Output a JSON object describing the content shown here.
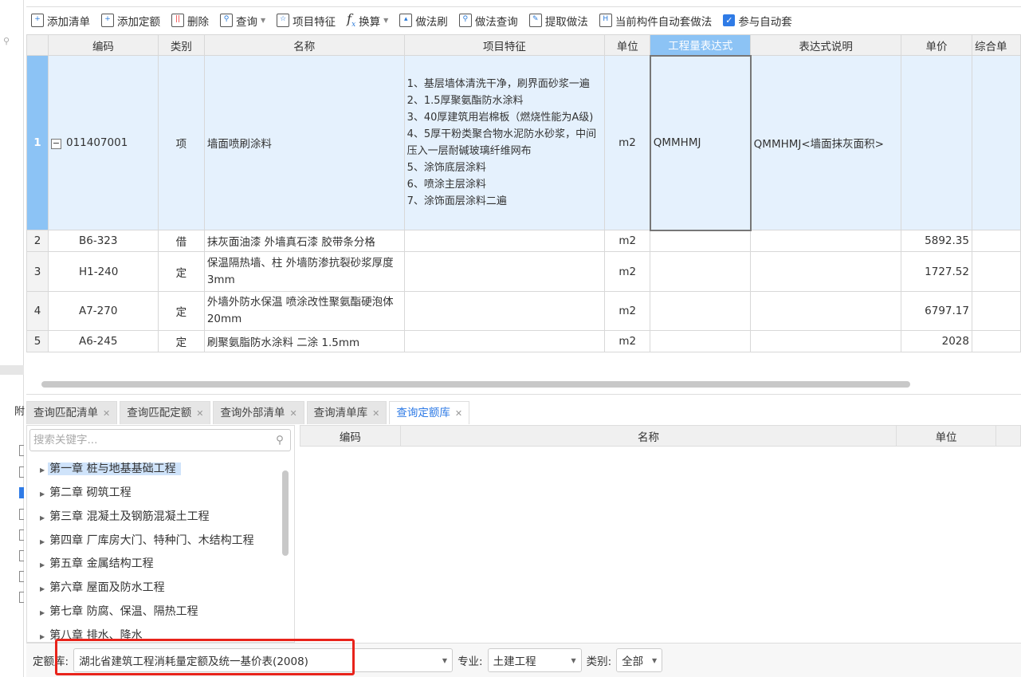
{
  "toolbar": {
    "items": [
      "添加清单",
      "添加定额",
      "删除",
      "查询",
      "项目特征",
      "换算",
      "做法刷",
      "做法查询",
      "提取做法",
      "当前构件自动套做法"
    ],
    "auto_checkbox": "参与自动套"
  },
  "grid": {
    "headers": [
      "",
      "编码",
      "类别",
      "名称",
      "项目特征",
      "单位",
      "工程量表达式",
      "表达式说明",
      "单价",
      "综合单"
    ],
    "rows": [
      {
        "no": "1",
        "code": "011407001",
        "type": "项",
        "name": "墙面喷刷涂料",
        "feature": [
          "1、基层墙体清洗干净，刷界面砂浆一遍",
          "2、1.5厚聚氨酯防水涂料",
          "3、40厚建筑用岩棉板（燃烧性能为A级)",
          "4、5厚干粉类聚合物水泥防水砂浆，中间压入一层耐碱玻璃纤维网布",
          "5、涂饰底层涂料",
          "6、喷涂主层涂料",
          "7、涂饰面层涂料二遍"
        ],
        "unit": "m2",
        "expr": "QMMHMJ",
        "expr_desc": "QMMHMJ<墙面抹灰面积>",
        "price": ""
      },
      {
        "no": "2",
        "code": "B6-323",
        "type": "借",
        "name": "抹灰面油漆 外墙真石漆 胶带条分格",
        "unit": "m2",
        "price": "5892.35"
      },
      {
        "no": "3",
        "code": "H1-240",
        "type": "定",
        "name": "保温隔热墙、柱 外墙防渗抗裂砂浆厚度3mm",
        "unit": "m2",
        "price": "1727.52"
      },
      {
        "no": "4",
        "code": "A7-270",
        "type": "定",
        "name": "外墙外防水保温 喷涂改性聚氨酯硬泡体 20mm",
        "unit": "m2",
        "price": "6797.17"
      },
      {
        "no": "5",
        "code": "A6-245",
        "type": "定",
        "name": "刷聚氨脂防水涂料 二涂 1.5mm",
        "unit": "m2",
        "price": "2028"
      }
    ]
  },
  "left_strip": {
    "header": "附"
  },
  "tabs": [
    "查询匹配清单",
    "查询匹配定额",
    "查询外部清单",
    "查询清单库",
    "查询定额库"
  ],
  "search": {
    "placeholder": "搜索关键字..."
  },
  "tree": [
    "第一章  桩与地基基础工程",
    "第二章  砌筑工程",
    "第三章  混凝土及钢筋混凝土工程",
    "第四章  厂库房大门、特种门、木结构工程",
    "第五章  金属结构工程",
    "第六章  屋面及防水工程",
    "第七章  防腐、保温、隔热工程",
    "第八章  排水、降水"
  ],
  "result_table": {
    "headers": [
      "编码",
      "名称",
      "单位"
    ]
  },
  "bottom": {
    "lib_label": "定额库:",
    "lib_value": "湖北省建筑工程消耗量定额及统一基价表(2008)",
    "major_label": "专业:",
    "major_value": "土建工程",
    "cat_label": "类别:",
    "cat_value": "全部"
  }
}
